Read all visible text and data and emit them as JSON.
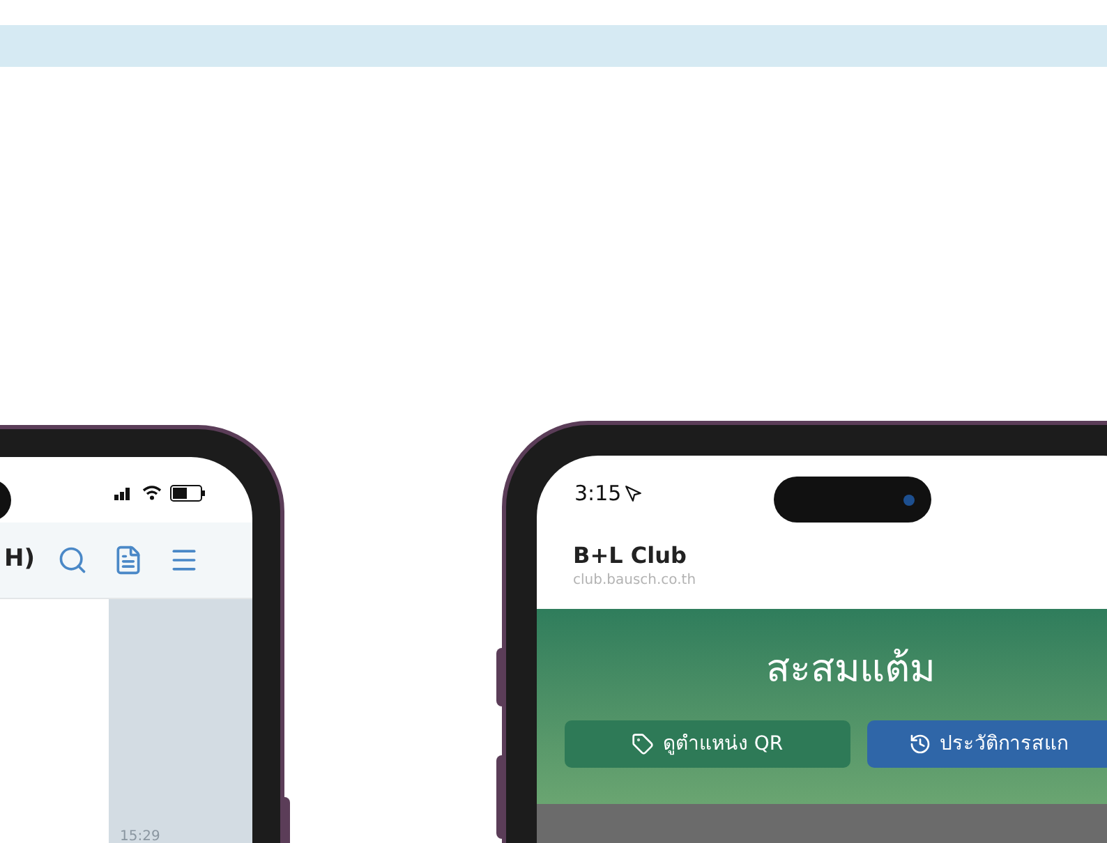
{
  "left_phone": {
    "header_title": "H)",
    "time_stamp": "15:29"
  },
  "right_phone": {
    "status_time": "3:15",
    "site_title": "B+L Club",
    "site_url": "club.bausch.co.th",
    "banner_title": "สะสมแต้ม",
    "buttons": [
      {
        "kind": "qr",
        "label": "ดูตำแหน่ง QR"
      },
      {
        "kind": "history",
        "label": "ประวัติการสแก"
      }
    ]
  }
}
